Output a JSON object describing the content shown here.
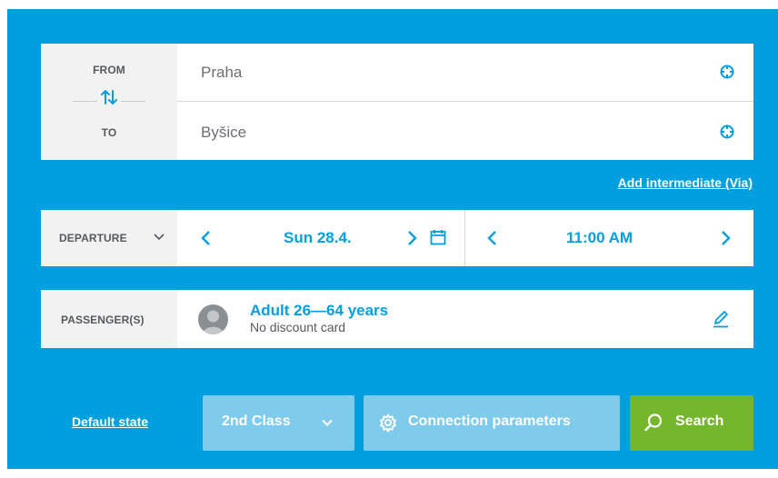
{
  "colors": {
    "accent": "#009fdf",
    "search": "#74b72c",
    "secondary_button": "#7fcbec",
    "label_bg": "#f2f2f2"
  },
  "route": {
    "from_label": "FROM",
    "to_label": "TO",
    "from_value": "Praha",
    "to_value": "Byšice",
    "swap_icon": "swap-arrows-icon",
    "location_icon": "crosshair-icon"
  },
  "via_link": "Add intermediate (Via)",
  "departure": {
    "label": "DEPARTURE",
    "date": "Sun 28.4.",
    "time": "11:00 AM"
  },
  "passengers": {
    "label": "PASSENGER(S)",
    "name": "Adult 26—64 years",
    "discount": "No discount card"
  },
  "footer": {
    "default_state": "Default state",
    "class_label": "2nd Class",
    "params_label": "Connection parameters",
    "search_label": "Search"
  }
}
